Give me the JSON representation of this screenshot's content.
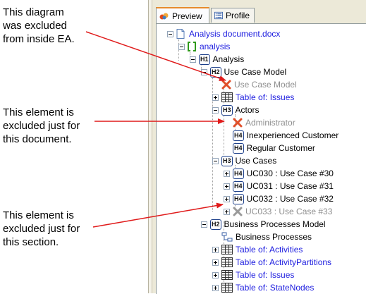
{
  "annotations": {
    "note1": "This diagram\nwas excluded\nfrom inside EA.",
    "note2": "This element is\nexcluded just for\nthis document.",
    "note3": "This element is\nexcluded just for\nthis section."
  },
  "tabs": [
    {
      "label": "Preview"
    },
    {
      "label": "Profile"
    }
  ],
  "tree": {
    "root": "Analysis document.docx",
    "analysis": "analysis",
    "h1_analysis": {
      "badge": "H1",
      "label": "Analysis"
    },
    "h2_use_case_model": {
      "badge": "H2",
      "label": "Use Case Model"
    },
    "use_case_model_diagram": "Use Case Model",
    "table_issues_1": "Table of: Issues",
    "h3_actors": {
      "badge": "H3",
      "label": "Actors"
    },
    "administrator": "Administrator",
    "h4_inexperienced": {
      "badge": "H4",
      "label": "Inexperienced Customer"
    },
    "h4_regular": {
      "badge": "H4",
      "label": "Regular Customer"
    },
    "h3_use_cases": {
      "badge": "H3",
      "label": "Use Cases"
    },
    "uc030": {
      "badge": "H4",
      "label": "UC030 : Use Case #30"
    },
    "uc031": {
      "badge": "H4",
      "label": "UC031 : Use Case #31"
    },
    "uc032": {
      "badge": "H4",
      "label": "UC032 : Use Case #32"
    },
    "uc033": "UC033 : Use Case #33",
    "h2_bpm": {
      "badge": "H2",
      "label": "Business Processes Model"
    },
    "business_processes": "Business Processes",
    "table_activities": "Table of: Activities",
    "table_activity_partitions": "Table of: ActivityPartitions",
    "table_issues_2": "Table of: Issues",
    "table_statenodes": "Table of: StateNodes"
  },
  "colors": {
    "arrow": "#e01b1b",
    "link_blue": "#1c1cdf",
    "excluded_gray": "#8e8e8e",
    "heading_border": "#1c3f8a"
  }
}
